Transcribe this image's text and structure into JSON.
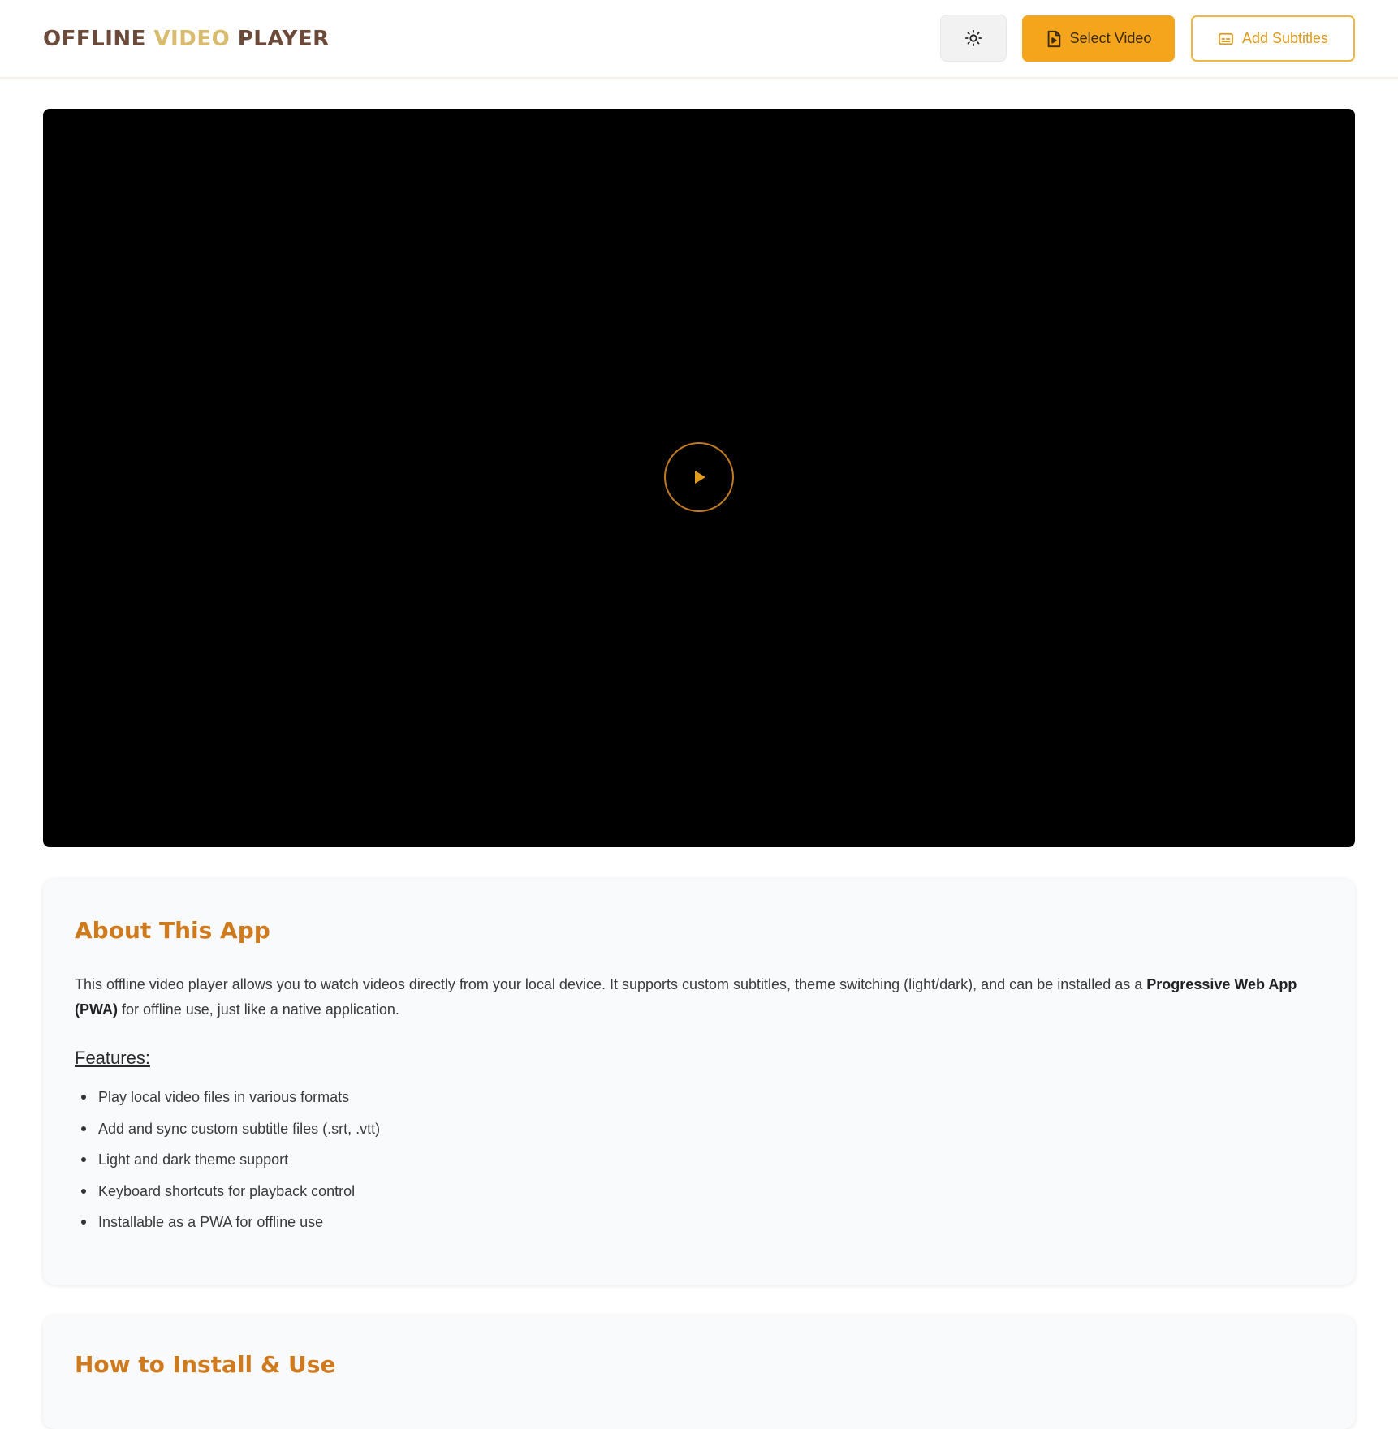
{
  "header": {
    "logo_part1": "OFFLINE ",
    "logo_part2": "VIDEO",
    "logo_part3": " PLAYER",
    "theme_toggle_icon": "sun-icon",
    "select_video_label": "Select Video",
    "select_video_icon": "file-video-icon",
    "add_subtitles_label": "Add Subtitles",
    "add_subtitles_icon": "subtitles-icon"
  },
  "player": {
    "play_icon": "play-icon"
  },
  "about": {
    "title": "About This App",
    "desc_before": "This offline video player allows you to watch videos directly from your local device. It supports custom subtitles, theme switching (light/dark), and can be installed as a ",
    "desc_bold": "Progressive Web App (PWA)",
    "desc_after": " for offline use, just like a native application.",
    "features_title": "Features:",
    "features": [
      "Play local video files in various formats",
      "Add and sync custom subtitle files (.srt, .vtt)",
      "Light and dark theme support",
      "Keyboard shortcuts for playback control",
      "Installable as a PWA for offline use"
    ]
  },
  "howto": {
    "title": "How to Install & Use"
  },
  "colors": {
    "accent": "#f4a51c",
    "heading": "#cf7a1c",
    "logo_dark": "#6b4a3a",
    "logo_light": "#d9bb6e"
  }
}
